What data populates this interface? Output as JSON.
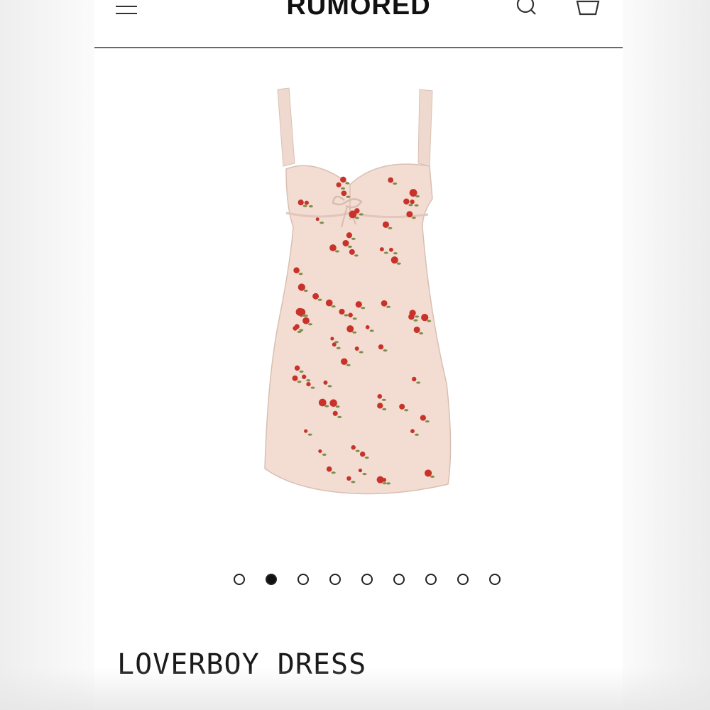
{
  "header": {
    "brand": "RUMORED",
    "menu_icon": "hamburger-menu-icon",
    "search_icon": "search-icon",
    "bag_icon": "shopping-bag-icon"
  },
  "product": {
    "title": "LOVERBOY DRESS",
    "image": "floral-slip-dress-image",
    "colors": {
      "fabric": "#f3ddd3",
      "flower": "#c8322a",
      "leaf": "#7e8e4a"
    }
  },
  "carousel": {
    "count": 9,
    "active_index": 1
  }
}
